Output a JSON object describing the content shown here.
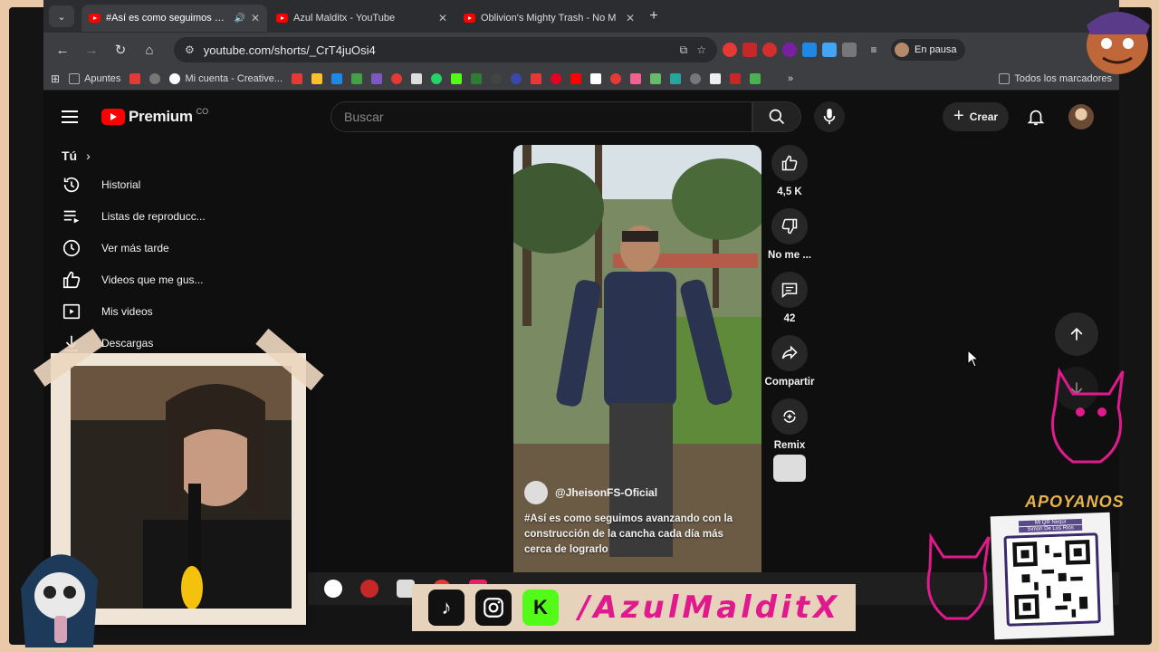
{
  "browser": {
    "tabs": [
      {
        "title": "#Así es como seguimos ava",
        "active": true,
        "audio": true
      },
      {
        "title": "Azul Malditx - YouTube",
        "active": false
      },
      {
        "title": "Oblivion's Mighty Trash - No M",
        "active": false
      }
    ],
    "new_tab": "+",
    "url": "youtube.com/shorts/_CrT4juOsi4",
    "profile_status": "En pausa",
    "bookmarks": [
      {
        "label": "Apuntes",
        "color": "#aaaaaa"
      },
      {
        "label": "Mi cuenta - Creative...",
        "color": "#ffffff"
      }
    ],
    "bookmarks_all": "Todos los marcadores",
    "more": "»"
  },
  "youtube": {
    "logo_text": "Premium",
    "logo_country": "CO",
    "search_placeholder": "Buscar",
    "create_label": "Crear",
    "guide": {
      "you_label": "Tú",
      "items": [
        {
          "label": "Historial",
          "icon": "history-icon"
        },
        {
          "label": "Listas de reproducc...",
          "icon": "playlist-icon"
        },
        {
          "label": "Ver más tarde",
          "icon": "clock-icon"
        },
        {
          "label": "Videos que me gus...",
          "icon": "thumb-up-icon"
        },
        {
          "label": "Mis videos",
          "icon": "video-icon"
        },
        {
          "label": "Descargas",
          "icon": "download-icon"
        }
      ]
    },
    "short": {
      "channel": "@JheisonFS-Oficial",
      "title": "#Así es como seguimos avanzando con la construcción de la cancha cada día más cerca de lograrlo"
    },
    "actions": {
      "likes": "4,5 K",
      "dislike": "No me ...",
      "comments": "42",
      "share": "Compartir",
      "remix": "Remix"
    }
  },
  "overlay": {
    "handle": "/AzulMalditX",
    "apoyanos": "APOYANOS",
    "qr_line1": "Mi QR Nequi",
    "qr_line2": "Simon De Los Rios",
    "social": [
      "tiktok-icon",
      "instagram-icon",
      "kick-icon"
    ],
    "accent": "#e0198c"
  }
}
